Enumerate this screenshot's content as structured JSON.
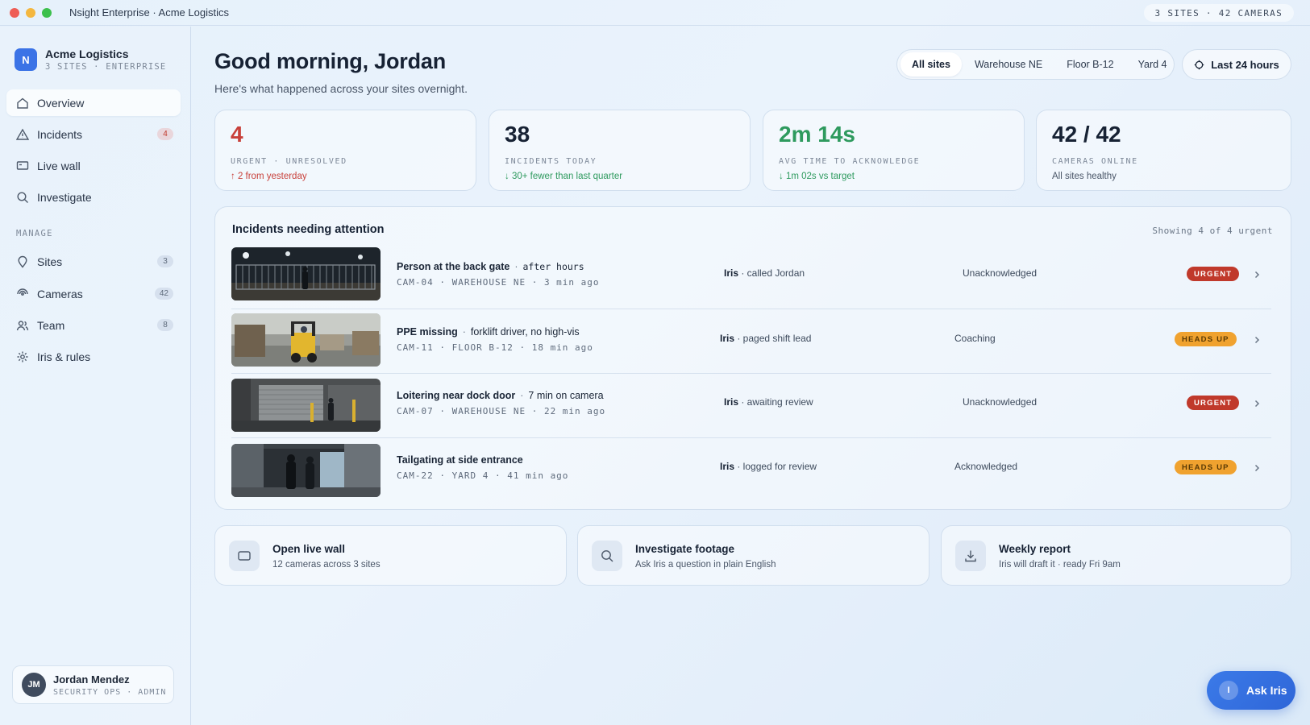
{
  "window": {
    "title": "Nsight Enterprise · Acme Logistics",
    "status": "3 SITES · 42 CAMERAS"
  },
  "sidebar": {
    "org": {
      "logo": "N",
      "name": "Acme Logistics",
      "sub": "3 SITES · ENTERPRISE"
    },
    "items": [
      {
        "label": "Overview",
        "icon": "home-icon"
      },
      {
        "label": "Incidents",
        "icon": "alert-triangle-icon",
        "count": "4"
      },
      {
        "label": "Live wall",
        "icon": "monitor-icon"
      },
      {
        "label": "Investigate",
        "icon": "search-icon"
      }
    ],
    "section_label": "MANAGE",
    "manage_items": [
      {
        "label": "Sites",
        "icon": "pin-icon",
        "count": "3"
      },
      {
        "label": "Cameras",
        "icon": "camera-icon",
        "count": "42"
      },
      {
        "label": "Team",
        "icon": "team-icon",
        "count": "8"
      },
      {
        "label": "Iris & rules",
        "icon": "sparkle-icon"
      }
    ],
    "user": {
      "initials": "JM",
      "name": "Jordan Mendez",
      "role": "SECURITY OPS · ADMIN"
    }
  },
  "header": {
    "greeting": "Good morning, Jordan",
    "subtitle": "Here's what happened across your sites overnight.",
    "filters": [
      "All sites",
      "Warehouse NE",
      "Floor B-12",
      "Yard 4"
    ],
    "active_filter": "All sites",
    "time_range": "Last 24 hours"
  },
  "stats": [
    {
      "value": "4",
      "label": "URGENT · UNRESOLVED",
      "delta": "↑ 2 from yesterday",
      "tone": "red"
    },
    {
      "value": "38",
      "label": "INCIDENTS TODAY",
      "delta": "↓ 30+ fewer than last quarter",
      "tone": "green"
    },
    {
      "value": "2m 14s",
      "label": "AVG TIME TO ACKNOWLEDGE",
      "delta": "↓ 1m 02s vs target",
      "tone": "green"
    },
    {
      "value": "42 / 42",
      "label": "CAMERAS ONLINE",
      "delta": "All sites healthy",
      "tone": "neutral"
    }
  ],
  "incidents": {
    "title": "Incidents needing attention",
    "meta": "Showing 4 of 4 urgent",
    "rows": [
      {
        "title": "Person at the back gate",
        "extra": "after hours",
        "extra_mono": true,
        "meta": "CAM-04 · WAREHOUSE NE · 3 min ago",
        "agent": "Iris",
        "action": " · called Jordan",
        "status": "Unacknowledged",
        "badge": "URGENT",
        "badge_type": "urgent"
      },
      {
        "title": "PPE missing",
        "extra": "forklift driver, no high-vis",
        "extra_mono": false,
        "meta": "CAM-11 · FLOOR B-12 · 18 min ago",
        "agent": "Iris",
        "action": " · paged shift lead",
        "status": "Coaching",
        "badge": "HEADS UP",
        "badge_type": "heads"
      },
      {
        "title": "Loitering near dock door",
        "extra": "7 min on camera",
        "extra_mono": false,
        "meta": "CAM-07 · WAREHOUSE NE · 22 min ago",
        "agent": "Iris",
        "action": " · awaiting review",
        "status": "Unacknowledged",
        "badge": "URGENT",
        "badge_type": "urgent"
      },
      {
        "title": "Tailgating at side entrance",
        "extra": "",
        "extra_mono": false,
        "meta": "CAM-22 · YARD 4 · 41 min ago",
        "agent": "Iris",
        "action": " · logged for review",
        "status": "Acknowledged",
        "badge": "HEADS UP",
        "badge_type": "heads"
      }
    ]
  },
  "actions": [
    {
      "title": "Open live wall",
      "sub": "12 cameras across 3 sites",
      "icon": "monitor-icon"
    },
    {
      "title": "Investigate footage",
      "sub": "Ask Iris a question in plain English",
      "icon": "search-icon"
    },
    {
      "title": "Weekly report",
      "sub": "Iris will draft it · ready Fri 9am",
      "icon": "download-icon"
    }
  ],
  "ask": {
    "label": "Ask Iris",
    "dot": "I"
  },
  "colors": {
    "accent": "#3b73e6",
    "urgent": "#c0392b",
    "heads_up": "#f0a22f",
    "positive": "#2e9a5e"
  }
}
